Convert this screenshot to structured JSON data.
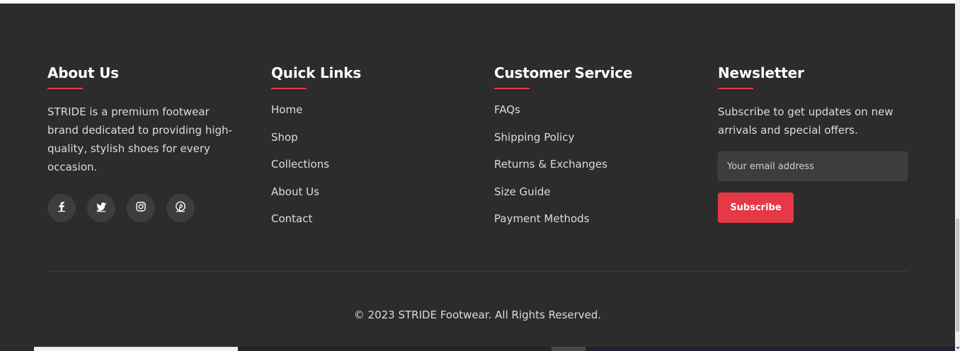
{
  "about": {
    "title": "About Us",
    "text": "STRIDE is a premium footwear brand dedicated to providing high-quality, stylish shoes for every occasion.",
    "socials": [
      {
        "icon": "facebook-icon"
      },
      {
        "icon": "twitter-icon"
      },
      {
        "icon": "instagram-icon"
      },
      {
        "icon": "pinterest-icon"
      }
    ]
  },
  "quick_links": {
    "title": "Quick Links",
    "items": [
      "Home",
      "Shop",
      "Collections",
      "About Us",
      "Contact"
    ]
  },
  "customer_service": {
    "title": "Customer Service",
    "items": [
      "FAQs",
      "Shipping Policy",
      "Returns & Exchanges",
      "Size Guide",
      "Payment Methods"
    ]
  },
  "newsletter": {
    "title": "Newsletter",
    "text": "Subscribe to get updates on new arrivals and special offers.",
    "email_placeholder": "Your email address",
    "button_label": "Subscribe"
  },
  "copyright": "© 2023 STRIDE Footwear. All Rights Reserved.",
  "colors": {
    "background": "#2c2c2c",
    "accent": "#e63946",
    "social_bg": "#3d3d3d",
    "text": "#dcdcdc",
    "heading": "#ffffff"
  }
}
